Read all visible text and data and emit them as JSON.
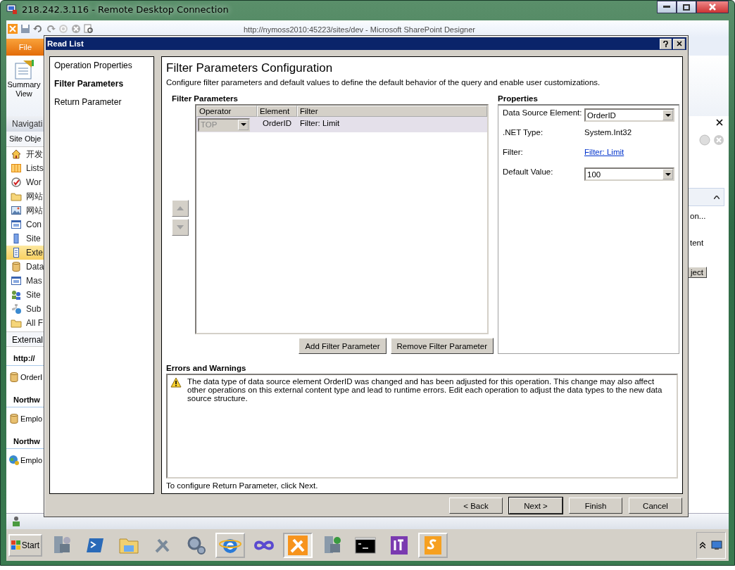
{
  "remote_window": {
    "title": "218.242.3.116 - Remote Desktop Connection"
  },
  "app": {
    "title": "http://nymoss2010:45223/sites/dev  -  Microsoft SharePoint Designer",
    "file_tab": "File",
    "ribbon_button": "Summary View"
  },
  "navigation": {
    "header": "Navigati",
    "section": "Site Obje",
    "items": [
      {
        "label": "开发",
        "selected": false
      },
      {
        "label": "Lists",
        "selected": false
      },
      {
        "label": "Wor",
        "selected": false
      },
      {
        "label": "网站",
        "selected": false
      },
      {
        "label": "网站",
        "selected": false
      },
      {
        "label": "Con",
        "selected": false
      },
      {
        "label": "Site",
        "selected": false
      },
      {
        "label": "Exte",
        "selected": true
      },
      {
        "label": "Data",
        "selected": false
      },
      {
        "label": "Mas",
        "selected": false
      },
      {
        "label": "Site",
        "selected": false
      },
      {
        "label": "Sub",
        "selected": false
      },
      {
        "label": "All F",
        "selected": false
      }
    ],
    "external_header": "External",
    "external_list": [
      {
        "kind": "heading",
        "label": "http://"
      },
      {
        "kind": "source",
        "label": "OrderI"
      },
      {
        "kind": "heading",
        "label": "Northw"
      },
      {
        "kind": "source",
        "label": "Emplo"
      },
      {
        "kind": "heading",
        "label": "Northw"
      },
      {
        "kind": "service",
        "label": "Emplo"
      }
    ]
  },
  "right_pane": {
    "item": "on...",
    "text": "tent",
    "button": "ject"
  },
  "dialog": {
    "title": "Read List",
    "steps": [
      {
        "label": "Operation Properties",
        "selected": false
      },
      {
        "label": "Filter Parameters",
        "selected": true
      },
      {
        "label": "Return Parameter",
        "selected": false
      }
    ],
    "heading": "Filter Parameters Configuration",
    "description": "Configure filter parameters and default values to define the default behavior of the query and enable user customizations.",
    "filter_section": "Filter Parameters",
    "move_up": {
      "disabled": true
    },
    "move_down": {
      "disabled": true
    },
    "table": {
      "columns": [
        "Operator",
        "Element",
        "Filter"
      ],
      "rows": [
        {
          "operator": "TOP",
          "operator_disabled": true,
          "element": "OrderID",
          "filter": "Filter: Limit",
          "selected": true
        }
      ]
    },
    "table_buttons": [
      "Add Filter Parameter",
      "Remove Filter Parameter"
    ],
    "properties_title": "Properties",
    "properties": [
      {
        "kind": "dropdown",
        "label": "Data Source Element:",
        "value": "OrderID"
      },
      {
        "kind": "text",
        "label": ".NET Type:",
        "value": "System.Int32"
      },
      {
        "kind": "link",
        "label": "Filter:",
        "value": "Filter: Limit"
      },
      {
        "kind": "dropdown",
        "label": "Default Value:",
        "value": "100"
      }
    ],
    "errors_title": "Errors and Warnings",
    "warnings": [
      "The data type of data source element OrderID was changed and has been adjusted for this operation. This change may also affect other operations on this external content type and lead to runtime errors. Edit each operation to adjust the data types to the new data source structure."
    ],
    "footer": "To configure Return Parameter, click Next.",
    "buttons": [
      {
        "label": "< Back",
        "default": false
      },
      {
        "label": "Next >",
        "default": true
      },
      {
        "label": "Finish",
        "default": false
      },
      {
        "label": "Cancel",
        "default": false
      }
    ]
  },
  "taskbar": {
    "start": "Start",
    "apps": [
      {
        "open": false,
        "selected": false
      },
      {
        "open": false,
        "selected": false
      },
      {
        "open": false,
        "selected": false
      },
      {
        "open": false,
        "selected": false
      },
      {
        "open": false,
        "selected": false
      },
      {
        "open": true,
        "selected": false
      },
      {
        "open": false,
        "selected": false
      },
      {
        "open": true,
        "selected": true
      },
      {
        "open": false,
        "selected": false
      },
      {
        "open": false,
        "selected": false
      },
      {
        "open": false,
        "selected": false
      },
      {
        "open": true,
        "selected": false
      }
    ]
  }
}
